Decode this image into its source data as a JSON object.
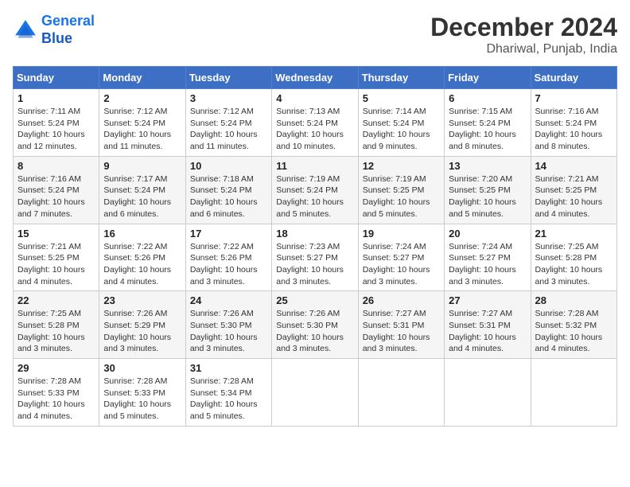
{
  "header": {
    "logo_line1": "General",
    "logo_line2": "Blue",
    "month_year": "December 2024",
    "location": "Dhariwal, Punjab, India"
  },
  "weekdays": [
    "Sunday",
    "Monday",
    "Tuesday",
    "Wednesday",
    "Thursday",
    "Friday",
    "Saturday"
  ],
  "weeks": [
    [
      {
        "day": "1",
        "sunrise": "7:11 AM",
        "sunset": "5:24 PM",
        "daylight": "10 hours and 12 minutes."
      },
      {
        "day": "2",
        "sunrise": "7:12 AM",
        "sunset": "5:24 PM",
        "daylight": "10 hours and 11 minutes."
      },
      {
        "day": "3",
        "sunrise": "7:12 AM",
        "sunset": "5:24 PM",
        "daylight": "10 hours and 11 minutes."
      },
      {
        "day": "4",
        "sunrise": "7:13 AM",
        "sunset": "5:24 PM",
        "daylight": "10 hours and 10 minutes."
      },
      {
        "day": "5",
        "sunrise": "7:14 AM",
        "sunset": "5:24 PM",
        "daylight": "10 hours and 9 minutes."
      },
      {
        "day": "6",
        "sunrise": "7:15 AM",
        "sunset": "5:24 PM",
        "daylight": "10 hours and 8 minutes."
      },
      {
        "day": "7",
        "sunrise": "7:16 AM",
        "sunset": "5:24 PM",
        "daylight": "10 hours and 8 minutes."
      }
    ],
    [
      {
        "day": "8",
        "sunrise": "7:16 AM",
        "sunset": "5:24 PM",
        "daylight": "10 hours and 7 minutes."
      },
      {
        "day": "9",
        "sunrise": "7:17 AM",
        "sunset": "5:24 PM",
        "daylight": "10 hours and 6 minutes."
      },
      {
        "day": "10",
        "sunrise": "7:18 AM",
        "sunset": "5:24 PM",
        "daylight": "10 hours and 6 minutes."
      },
      {
        "day": "11",
        "sunrise": "7:19 AM",
        "sunset": "5:24 PM",
        "daylight": "10 hours and 5 minutes."
      },
      {
        "day": "12",
        "sunrise": "7:19 AM",
        "sunset": "5:25 PM",
        "daylight": "10 hours and 5 minutes."
      },
      {
        "day": "13",
        "sunrise": "7:20 AM",
        "sunset": "5:25 PM",
        "daylight": "10 hours and 5 minutes."
      },
      {
        "day": "14",
        "sunrise": "7:21 AM",
        "sunset": "5:25 PM",
        "daylight": "10 hours and 4 minutes."
      }
    ],
    [
      {
        "day": "15",
        "sunrise": "7:21 AM",
        "sunset": "5:25 PM",
        "daylight": "10 hours and 4 minutes."
      },
      {
        "day": "16",
        "sunrise": "7:22 AM",
        "sunset": "5:26 PM",
        "daylight": "10 hours and 4 minutes."
      },
      {
        "day": "17",
        "sunrise": "7:22 AM",
        "sunset": "5:26 PM",
        "daylight": "10 hours and 3 minutes."
      },
      {
        "day": "18",
        "sunrise": "7:23 AM",
        "sunset": "5:27 PM",
        "daylight": "10 hours and 3 minutes."
      },
      {
        "day": "19",
        "sunrise": "7:24 AM",
        "sunset": "5:27 PM",
        "daylight": "10 hours and 3 minutes."
      },
      {
        "day": "20",
        "sunrise": "7:24 AM",
        "sunset": "5:27 PM",
        "daylight": "10 hours and 3 minutes."
      },
      {
        "day": "21",
        "sunrise": "7:25 AM",
        "sunset": "5:28 PM",
        "daylight": "10 hours and 3 minutes."
      }
    ],
    [
      {
        "day": "22",
        "sunrise": "7:25 AM",
        "sunset": "5:28 PM",
        "daylight": "10 hours and 3 minutes."
      },
      {
        "day": "23",
        "sunrise": "7:26 AM",
        "sunset": "5:29 PM",
        "daylight": "10 hours and 3 minutes."
      },
      {
        "day": "24",
        "sunrise": "7:26 AM",
        "sunset": "5:30 PM",
        "daylight": "10 hours and 3 minutes."
      },
      {
        "day": "25",
        "sunrise": "7:26 AM",
        "sunset": "5:30 PM",
        "daylight": "10 hours and 3 minutes."
      },
      {
        "day": "26",
        "sunrise": "7:27 AM",
        "sunset": "5:31 PM",
        "daylight": "10 hours and 3 minutes."
      },
      {
        "day": "27",
        "sunrise": "7:27 AM",
        "sunset": "5:31 PM",
        "daylight": "10 hours and 4 minutes."
      },
      {
        "day": "28",
        "sunrise": "7:28 AM",
        "sunset": "5:32 PM",
        "daylight": "10 hours and 4 minutes."
      }
    ],
    [
      {
        "day": "29",
        "sunrise": "7:28 AM",
        "sunset": "5:33 PM",
        "daylight": "10 hours and 4 minutes."
      },
      {
        "day": "30",
        "sunrise": "7:28 AM",
        "sunset": "5:33 PM",
        "daylight": "10 hours and 5 minutes."
      },
      {
        "day": "31",
        "sunrise": "7:28 AM",
        "sunset": "5:34 PM",
        "daylight": "10 hours and 5 minutes."
      },
      null,
      null,
      null,
      null
    ]
  ]
}
